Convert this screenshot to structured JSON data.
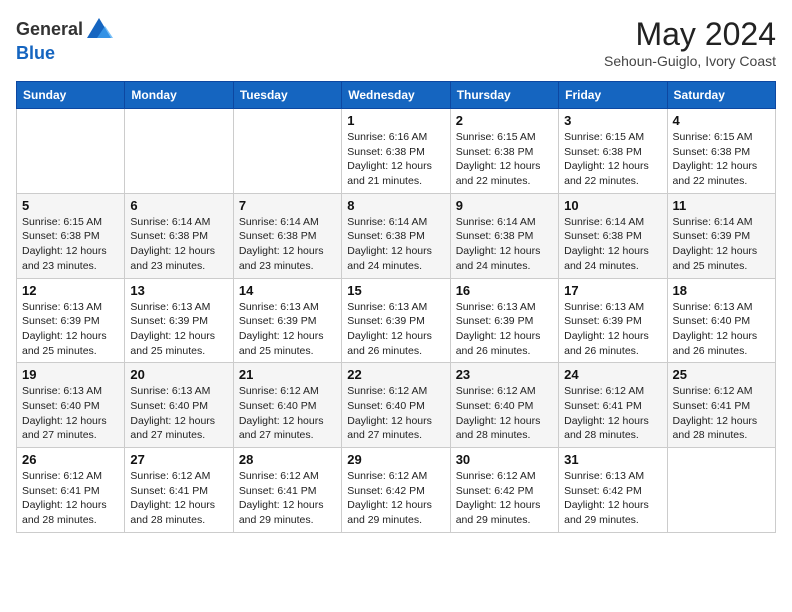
{
  "header": {
    "logo_general": "General",
    "logo_blue": "Blue",
    "month_title": "May 2024",
    "subtitle": "Sehoun-Guiglo, Ivory Coast"
  },
  "days_of_week": [
    "Sunday",
    "Monday",
    "Tuesday",
    "Wednesday",
    "Thursday",
    "Friday",
    "Saturday"
  ],
  "weeks": [
    [
      {
        "day": "",
        "info": ""
      },
      {
        "day": "",
        "info": ""
      },
      {
        "day": "",
        "info": ""
      },
      {
        "day": "1",
        "info": "Sunrise: 6:16 AM\nSunset: 6:38 PM\nDaylight: 12 hours and 21 minutes."
      },
      {
        "day": "2",
        "info": "Sunrise: 6:15 AM\nSunset: 6:38 PM\nDaylight: 12 hours and 22 minutes."
      },
      {
        "day": "3",
        "info": "Sunrise: 6:15 AM\nSunset: 6:38 PM\nDaylight: 12 hours and 22 minutes."
      },
      {
        "day": "4",
        "info": "Sunrise: 6:15 AM\nSunset: 6:38 PM\nDaylight: 12 hours and 22 minutes."
      }
    ],
    [
      {
        "day": "5",
        "info": "Sunrise: 6:15 AM\nSunset: 6:38 PM\nDaylight: 12 hours and 23 minutes."
      },
      {
        "day": "6",
        "info": "Sunrise: 6:14 AM\nSunset: 6:38 PM\nDaylight: 12 hours and 23 minutes."
      },
      {
        "day": "7",
        "info": "Sunrise: 6:14 AM\nSunset: 6:38 PM\nDaylight: 12 hours and 23 minutes."
      },
      {
        "day": "8",
        "info": "Sunrise: 6:14 AM\nSunset: 6:38 PM\nDaylight: 12 hours and 24 minutes."
      },
      {
        "day": "9",
        "info": "Sunrise: 6:14 AM\nSunset: 6:38 PM\nDaylight: 12 hours and 24 minutes."
      },
      {
        "day": "10",
        "info": "Sunrise: 6:14 AM\nSunset: 6:38 PM\nDaylight: 12 hours and 24 minutes."
      },
      {
        "day": "11",
        "info": "Sunrise: 6:14 AM\nSunset: 6:39 PM\nDaylight: 12 hours and 25 minutes."
      }
    ],
    [
      {
        "day": "12",
        "info": "Sunrise: 6:13 AM\nSunset: 6:39 PM\nDaylight: 12 hours and 25 minutes."
      },
      {
        "day": "13",
        "info": "Sunrise: 6:13 AM\nSunset: 6:39 PM\nDaylight: 12 hours and 25 minutes."
      },
      {
        "day": "14",
        "info": "Sunrise: 6:13 AM\nSunset: 6:39 PM\nDaylight: 12 hours and 25 minutes."
      },
      {
        "day": "15",
        "info": "Sunrise: 6:13 AM\nSunset: 6:39 PM\nDaylight: 12 hours and 26 minutes."
      },
      {
        "day": "16",
        "info": "Sunrise: 6:13 AM\nSunset: 6:39 PM\nDaylight: 12 hours and 26 minutes."
      },
      {
        "day": "17",
        "info": "Sunrise: 6:13 AM\nSunset: 6:39 PM\nDaylight: 12 hours and 26 minutes."
      },
      {
        "day": "18",
        "info": "Sunrise: 6:13 AM\nSunset: 6:40 PM\nDaylight: 12 hours and 26 minutes."
      }
    ],
    [
      {
        "day": "19",
        "info": "Sunrise: 6:13 AM\nSunset: 6:40 PM\nDaylight: 12 hours and 27 minutes."
      },
      {
        "day": "20",
        "info": "Sunrise: 6:13 AM\nSunset: 6:40 PM\nDaylight: 12 hours and 27 minutes."
      },
      {
        "day": "21",
        "info": "Sunrise: 6:12 AM\nSunset: 6:40 PM\nDaylight: 12 hours and 27 minutes."
      },
      {
        "day": "22",
        "info": "Sunrise: 6:12 AM\nSunset: 6:40 PM\nDaylight: 12 hours and 27 minutes."
      },
      {
        "day": "23",
        "info": "Sunrise: 6:12 AM\nSunset: 6:40 PM\nDaylight: 12 hours and 28 minutes."
      },
      {
        "day": "24",
        "info": "Sunrise: 6:12 AM\nSunset: 6:41 PM\nDaylight: 12 hours and 28 minutes."
      },
      {
        "day": "25",
        "info": "Sunrise: 6:12 AM\nSunset: 6:41 PM\nDaylight: 12 hours and 28 minutes."
      }
    ],
    [
      {
        "day": "26",
        "info": "Sunrise: 6:12 AM\nSunset: 6:41 PM\nDaylight: 12 hours and 28 minutes."
      },
      {
        "day": "27",
        "info": "Sunrise: 6:12 AM\nSunset: 6:41 PM\nDaylight: 12 hours and 28 minutes."
      },
      {
        "day": "28",
        "info": "Sunrise: 6:12 AM\nSunset: 6:41 PM\nDaylight: 12 hours and 29 minutes."
      },
      {
        "day": "29",
        "info": "Sunrise: 6:12 AM\nSunset: 6:42 PM\nDaylight: 12 hours and 29 minutes."
      },
      {
        "day": "30",
        "info": "Sunrise: 6:12 AM\nSunset: 6:42 PM\nDaylight: 12 hours and 29 minutes."
      },
      {
        "day": "31",
        "info": "Sunrise: 6:13 AM\nSunset: 6:42 PM\nDaylight: 12 hours and 29 minutes."
      },
      {
        "day": "",
        "info": ""
      }
    ]
  ]
}
